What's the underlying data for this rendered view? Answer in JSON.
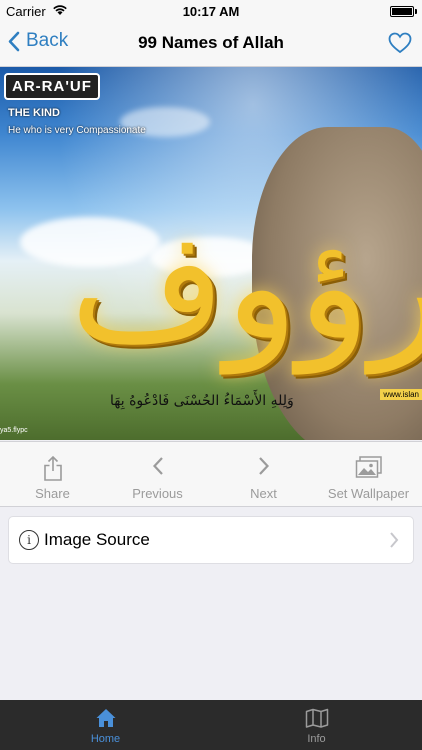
{
  "status": {
    "carrier": "Carrier",
    "time": "10:17 AM",
    "battery_level": 0.9
  },
  "nav": {
    "back_label": "Back",
    "title": "99 Names of Allah"
  },
  "hero": {
    "name": "AR-RA'UF",
    "kind": "THE KIND",
    "meaning": "He who is very Compassionate",
    "calligraphy": "الرؤوف",
    "verse": "وَلِلهِ الأَسْمَاءُ الحُسْنَى فَادْعُوهُ بِهَا",
    "watermark_right": "www.islan",
    "watermark_left": "ya5.flypc"
  },
  "toolbar": {
    "share": "Share",
    "previous": "Previous",
    "next": "Next",
    "wallpaper": "Set Wallpaper"
  },
  "source_cell": {
    "label": "Image Source"
  },
  "tabs": {
    "home": "Home",
    "info": "Info"
  },
  "colors": {
    "accent": "#2f7fc1",
    "tab_active": "#4a90d9",
    "tab_inactive": "#9b9b9b",
    "tab_bg": "#2b2b2b"
  }
}
